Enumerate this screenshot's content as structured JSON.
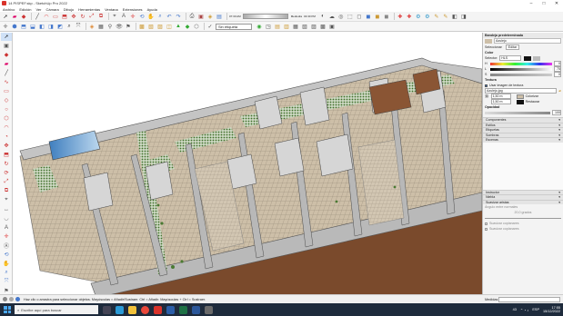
{
  "window": {
    "title": "14 PISPEF.skp - SketchUp Pro 2022"
  },
  "menu": [
    "Archivo",
    "Edición",
    "Ver",
    "Cámara",
    "Dibujo",
    "Herramientas",
    "Ventana",
    "Extensiones",
    "Ayuda"
  ],
  "toolbar1": {
    "icons": [
      "select-arrow",
      "eraser",
      "paint",
      "line",
      "arc",
      "rectangle",
      "push-pull",
      "move",
      "rotate",
      "scale",
      "offset",
      "tape",
      "text",
      "axes",
      "3d-text",
      "orbit",
      "pan",
      "zoom",
      "zoom-extents",
      "undo",
      "redo",
      "print",
      "model-info",
      "components",
      "materials",
      "styles",
      "layers",
      "scenes",
      "shadows",
      "fog",
      "xray",
      "back-edges",
      "wireframe",
      "hidden-line",
      "shaded",
      "textured",
      "monochrome"
    ],
    "timeline": [
      "07:30 AM",
      "Mediodía",
      "04:30 PM"
    ]
  },
  "toolbar2": {
    "tag_label": "Sin etiqueta",
    "icons": [
      "iso",
      "top",
      "front",
      "right",
      "back",
      "left",
      "bottom",
      "persp",
      "section",
      "scene-1",
      "scene-2",
      "scene-3"
    ]
  },
  "panel": {
    "title": "Bandeja predeterminada",
    "material_name": "Azulejo",
    "tabs": [
      "Seleccionar",
      "Editar"
    ],
    "color_label": "Color",
    "picker_label": "Selector:",
    "picker_value": "HLS",
    "h_label": "H",
    "h_value": "0",
    "l_label": "L",
    "l_value": "75",
    "s_label": "S",
    "s_value": "0",
    "texture_label": "Textura",
    "use_texture": "Usar imagen de textura",
    "texture_file": "Azulejo.jpg",
    "width_value": "1,50 m",
    "height_value": "1,50 m",
    "colorize": "Colorizar",
    "reset": "Restaurar",
    "opacity_label": "Opacidad",
    "opacity_value": "100",
    "sections": [
      "Componentes",
      "Estilos",
      "Etiquetas",
      "Sombras",
      "Escenas",
      "Instructor",
      "Niebla",
      "Suavizar aristas"
    ],
    "soften_label": "Ángulo entre normales",
    "soften_value": "20,0 grados",
    "soften_opts": [
      "Suavizar coplanares",
      "Suavizar coplanares"
    ],
    "measures_label": "Medidas"
  },
  "status": {
    "text": "Haz clic o arrastra para seleccionar objetos. Mayúsculas = Añadir/Sustraer. Ctrl = Añadir. Mayúsculas + Ctrl = Sustraer."
  },
  "taskbar": {
    "search_placeholder": "Escribe aquí para buscar",
    "temp": "43",
    "lang": "ESP",
    "time": "17:55",
    "date": "15/12/2022"
  },
  "colors": {
    "accent": "#3a7bd5",
    "floor_tile": "#c9bca6",
    "wall_grey": "#bfbfbf",
    "wood": "#7a4a2c",
    "taskbar": "#1e2b3c"
  }
}
